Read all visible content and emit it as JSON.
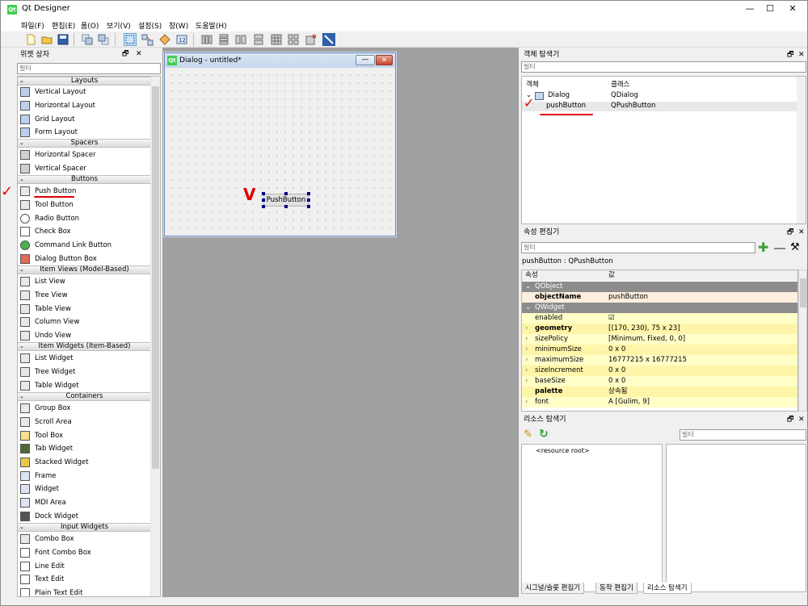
{
  "window": {
    "title": "Qt Designer",
    "minimize": "—",
    "maximize": "☐",
    "close": "✕"
  },
  "app_icon_text": "Qt",
  "menu": [
    "파일(F)",
    "편집(E)",
    "폼(O)",
    "보기(V)",
    "설정(S)",
    "창(W)",
    "도움말(H)"
  ],
  "colors": {
    "accent": "#0078d7",
    "category_bg": "#dadada",
    "selection": "#e8e8e8",
    "qobject_header": "#8c8c8c",
    "qobject_row": "#fdeedd",
    "qwidget_row": "#ffffc8"
  },
  "widget_box": {
    "title": "위젯 상자",
    "filter_placeholder": "필터",
    "categories": [
      {
        "name": "Layouts",
        "items": [
          "Vertical Layout",
          "Horizontal Layout",
          "Grid Layout",
          "Form Layout"
        ]
      },
      {
        "name": "Spacers",
        "items": [
          "Horizontal Spacer",
          "Vertical Spacer"
        ]
      },
      {
        "name": "Buttons",
        "items": [
          "Push Button",
          "Tool Button",
          "Radio Button",
          "Check Box",
          "Command Link Button",
          "Dialog Button Box"
        ]
      },
      {
        "name": "Item Views (Model-Based)",
        "items": [
          "List View",
          "Tree View",
          "Table View",
          "Column View",
          "Undo View"
        ]
      },
      {
        "name": "Item Widgets (Item-Based)",
        "items": [
          "List Widget",
          "Tree Widget",
          "Table Widget"
        ]
      },
      {
        "name": "Containers",
        "items": [
          "Group Box",
          "Scroll Area",
          "Tool Box",
          "Tab Widget",
          "Stacked Widget",
          "Frame",
          "Widget",
          "MDI Area",
          "Dock Widget"
        ]
      },
      {
        "name": "Input Widgets",
        "items": [
          "Combo Box",
          "Font Combo Box",
          "Line Edit",
          "Text Edit",
          "Plain Text Edit"
        ]
      }
    ]
  },
  "form": {
    "title": "Dialog - untitled*",
    "button_text": "PushButton"
  },
  "object_inspector": {
    "title": "객체 탐색기",
    "filter_placeholder": "필터",
    "col_object": "객체",
    "col_class": "클래스",
    "rows": [
      {
        "name": "Dialog",
        "class": "QDialog"
      },
      {
        "name": "pushButton",
        "class": "QPushButton"
      }
    ]
  },
  "property_editor": {
    "title": "속성 편집기",
    "filter_placeholder": "필터",
    "object_label": "pushButton : QPushButton",
    "col_property": "속성",
    "col_value": "값",
    "groups": [
      {
        "name": "QObject",
        "props": [
          {
            "name": "objectName",
            "value": "pushButton",
            "bold": true
          }
        ]
      },
      {
        "name": "QWidget",
        "props": [
          {
            "name": "enabled",
            "value": "☑",
            "bold": false
          },
          {
            "name": "geometry",
            "value": "[(170, 230), 75 x 23]",
            "bold": true
          },
          {
            "name": "sizePolicy",
            "value": "[Minimum, Fixed, 0, 0]",
            "bold": false
          },
          {
            "name": "minimumSize",
            "value": "0 x 0",
            "bold": false
          },
          {
            "name": "maximumSize",
            "value": "16777215 x 16777215",
            "bold": false
          },
          {
            "name": "sizeIncrement",
            "value": "0 x 0",
            "bold": false
          },
          {
            "name": "baseSize",
            "value": "0 x 0",
            "bold": false
          },
          {
            "name": "palette",
            "value": "상속됨",
            "bold": true
          },
          {
            "name": "font",
            "value": "A  [Gulim, 9]",
            "bold": false
          }
        ]
      }
    ]
  },
  "resource_browser": {
    "title": "리소스 탐색기",
    "filter_placeholder": "필터",
    "root": "<resource root>"
  },
  "bottom_tabs": [
    "시그널/슬롯 편집기",
    "동작 편집기",
    "리소스 탐색기"
  ],
  "dock_controls": {
    "float": "🗗",
    "close": "✕"
  }
}
